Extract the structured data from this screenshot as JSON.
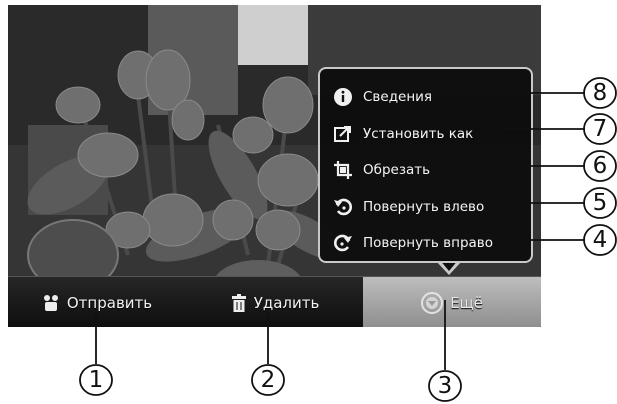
{
  "action_bar": {
    "share_label": "Отправить",
    "delete_label": "Удалить",
    "more_label": "Ещё"
  },
  "menu": {
    "items": [
      {
        "label": "Сведения",
        "icon": "info-icon"
      },
      {
        "label": "Установить как",
        "icon": "set-as-icon"
      },
      {
        "label": "Обрезать",
        "icon": "crop-icon"
      },
      {
        "label": "Повернуть влево",
        "icon": "rotate-left-icon"
      },
      {
        "label": "Повернуть вправо",
        "icon": "rotate-right-icon"
      }
    ]
  },
  "callouts": {
    "n1": "1",
    "n2": "2",
    "n3": "3",
    "n4": "4",
    "n5": "5",
    "n6": "6",
    "n7": "7",
    "n8": "8"
  }
}
